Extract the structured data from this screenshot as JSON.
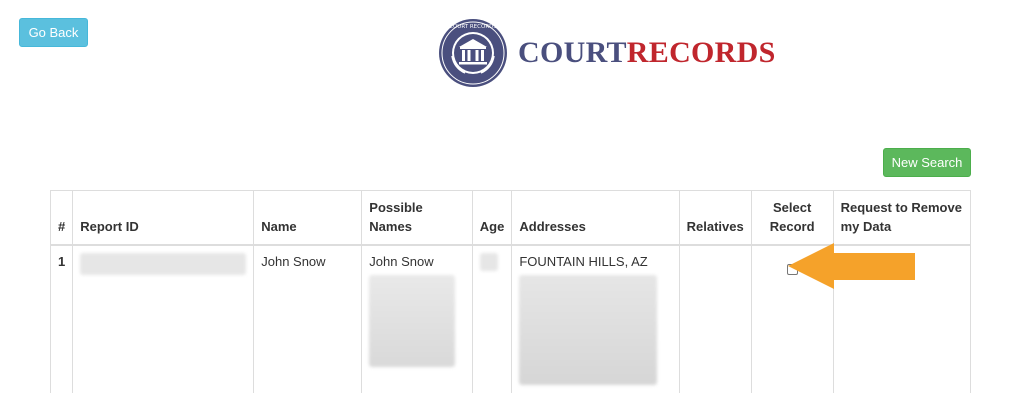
{
  "header": {
    "go_back_label": "Go Back",
    "logo": {
      "court": "COURT",
      "records": "RECORDS",
      "seal_top_text": "COURT RECORDS"
    }
  },
  "actions": {
    "new_search_label": "New Search"
  },
  "table": {
    "columns": {
      "num": "#",
      "report_id": "Report ID",
      "name": "Name",
      "possible_names": "Possible Names",
      "age": "Age",
      "addresses": "Addresses",
      "relatives": "Relatives",
      "select_record": "Select Record",
      "request_removal": "Request to Remove my Data"
    },
    "rows": [
      {
        "num": "1",
        "name": "John Snow",
        "possible_names_first": "John Snow",
        "address_first": "FOUNTAIN HILLS, AZ",
        "selected": false
      }
    ]
  },
  "colors": {
    "go_back_bg": "#5bc0de",
    "new_search_bg": "#5cb85c",
    "logo_court": "#4a4f7e",
    "logo_records": "#c0262d",
    "arrow": "#f5a22a"
  },
  "icons": {
    "arrow": "arrow-left-icon",
    "seal": "courthouse-seal-icon"
  }
}
